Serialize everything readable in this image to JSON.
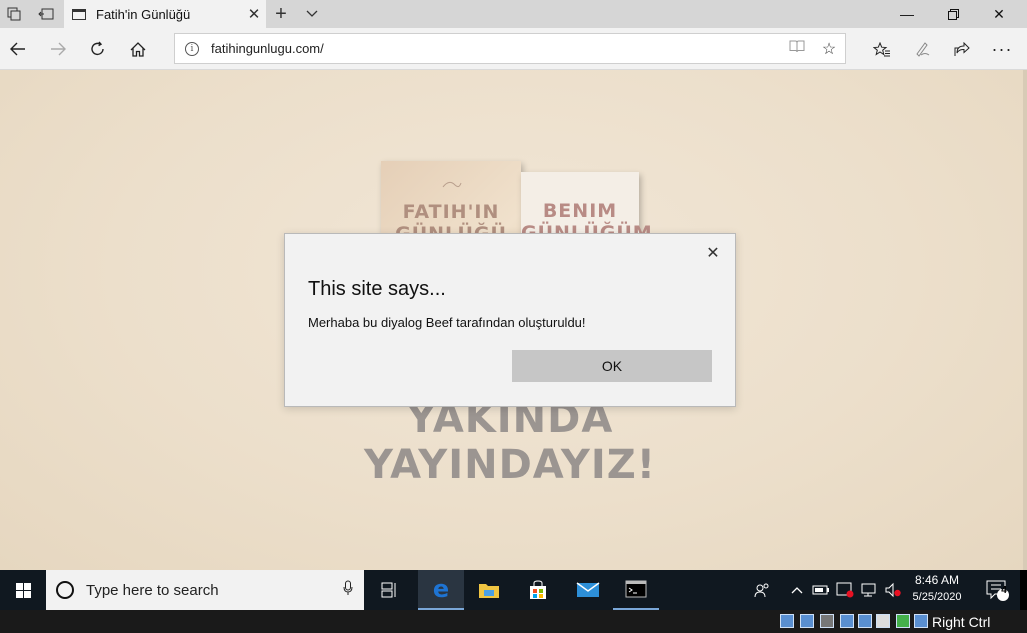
{
  "browser": {
    "tab_title": "Fatih'in Günlüğü",
    "url": "fatihingunlugu.com/"
  },
  "page": {
    "book1_title": "FATIH'IN GÜNLÜĞÜ",
    "book2_title": "BENIM GÜNLÜĞÜM",
    "slogan_line1": "YAKINDA",
    "slogan_line2": "YAYINDAYIZ!"
  },
  "dialog": {
    "heading": "This site says...",
    "message": "Merhaba bu diyalog Beef tarafından oluşturuldu!",
    "ok_label": "OK"
  },
  "taskbar": {
    "search_placeholder": "Type here to search",
    "time": "8:46 AM",
    "date": "5/25/2020",
    "notification_count": "4",
    "host_key": "Right Ctrl"
  },
  "colors": {
    "edge_blue": "#1e74d3",
    "taskbar_bg": "#101820",
    "page_bg": "#ecdfcb"
  }
}
